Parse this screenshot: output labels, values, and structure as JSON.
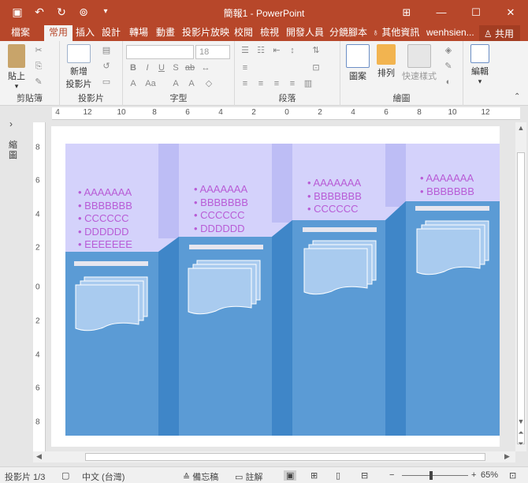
{
  "window": {
    "title": "簡報1 - PowerPoint"
  },
  "tabs": [
    {
      "label": "檔案"
    },
    {
      "label": "常用"
    },
    {
      "label": "插入"
    },
    {
      "label": "設計"
    },
    {
      "label": "轉場"
    },
    {
      "label": "動畫"
    },
    {
      "label": "投影片放映"
    },
    {
      "label": "校閱"
    },
    {
      "label": "檢視"
    },
    {
      "label": "開發人員"
    },
    {
      "label": "分鏡腳本"
    }
  ],
  "tell_me": "其他資訊",
  "user": "wenhsien...",
  "share_label": "共用",
  "ribbon": {
    "clipboard": {
      "group_label": "剪貼簿",
      "paste_label": "貼上"
    },
    "slides": {
      "group_label": "投影片",
      "new_slide_label": "新增",
      "new_slide_label2": "投影片"
    },
    "font": {
      "group_label": "字型",
      "font_size": "18"
    },
    "paragraph": {
      "group_label": "段落"
    },
    "drawing": {
      "group_label": "繪圖",
      "shapes_label": "圖案",
      "arrange_label": "排列",
      "quick_styles_label": "快速樣式"
    },
    "editing": {
      "label": "編輯"
    }
  },
  "left_pane": {
    "label": "縮圖"
  },
  "hruler_labels": [
    "4",
    "12",
    "10",
    "8",
    "6",
    "4",
    "2",
    "0",
    "2",
    "4",
    "6",
    "8",
    "10",
    "12"
  ],
  "vruler_labels": [
    "8",
    "6",
    "4",
    "2",
    "0",
    "2",
    "4",
    "6",
    "8"
  ],
  "slide": {
    "columns": [
      {
        "bullets": [
          "AAAAAAA",
          "BBBBBBB",
          "CCCCCC",
          "DDDDDD",
          "EEEEEEE"
        ]
      },
      {
        "bullets": [
          "AAAAAAA",
          "BBBBBBB",
          "CCCCCC",
          "DDDDDD"
        ]
      },
      {
        "bullets": [
          "AAAAAAA",
          "BBBBBBB",
          "CCCCCC"
        ]
      },
      {
        "bullets": [
          "AAAAAAA",
          "BBBBBBB"
        ]
      }
    ],
    "colors": {
      "lavender": "#d4d2fb",
      "lavender_gap": "#bdbdf5",
      "blue": "#5b9bd5",
      "blue_gap": "#3f86c8",
      "text": "#b85cd6"
    }
  },
  "status": {
    "slide_count": "投影片 1/3",
    "language": "中文 (台灣)",
    "notes_label": "備忘稿",
    "comments_label": "註解",
    "zoom": "65%"
  }
}
